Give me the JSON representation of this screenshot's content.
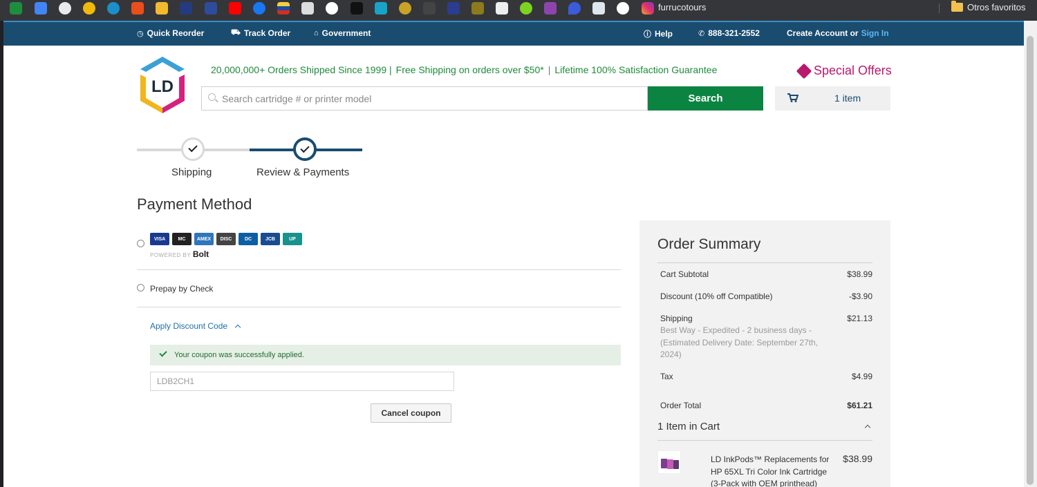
{
  "bookmarks": {
    "icons": [
      "drive-icon",
      "docs-icon",
      "globe-icon",
      "coin-icon",
      "circle-icon",
      "v-icon",
      "binance-icon",
      "paypal-icon",
      "z-icon",
      "youtube-icon",
      "facebook-icon",
      "flag-icon",
      "play-icon",
      "soccer-icon",
      "p-icon",
      "s-icon",
      "crown-icon",
      "tree-icon",
      "shield-icon",
      "g-icon",
      "os-icon",
      "green-icon",
      "mask-icon",
      "drop-icon",
      "bird-icon",
      "soccer-icon-2"
    ],
    "instagram_label": "furrucotours",
    "folder_label": "Otros favoritos"
  },
  "topnav": {
    "quick_reorder": "Quick Reorder",
    "track_order": "Track Order",
    "government": "Government",
    "help": "Help",
    "phone": "888-321-2552",
    "create_account": "Create Account or",
    "sign_in": "Sign In"
  },
  "header": {
    "logo_text": "LD",
    "tagline_1": "20,000,000+ Orders Shipped Since 1999 |",
    "tagline_2": "Free Shipping on orders over $50*",
    "tagline_3": "Lifetime 100% Satisfaction Guarantee",
    "special_offers": "Special Offers",
    "search_placeholder": "Search cartridge # or printer model",
    "search_button": "Search",
    "cart_label": "1 item"
  },
  "steps": {
    "step1": "Shipping",
    "step2": "Review & Payments"
  },
  "payment": {
    "title": "Payment Method",
    "cards": [
      {
        "name": "VISA",
        "color": "#1a3a8f"
      },
      {
        "name": "MC",
        "color": "#222222"
      },
      {
        "name": "AMEX",
        "color": "#2e77bb"
      },
      {
        "name": "DISC",
        "color": "#444444"
      },
      {
        "name": "DC",
        "color": "#0d5fa5"
      },
      {
        "name": "JCB",
        "color": "#1a4c8f"
      },
      {
        "name": "UP",
        "color": "#18928c"
      }
    ],
    "powered_by": "POWERED BY",
    "bolt": "Bolt",
    "prepay_label": "Prepay by Check",
    "discount_toggle": "Apply Discount Code",
    "coupon_success": "Your coupon was successfully applied.",
    "coupon_value": "LDB2CH1",
    "cancel_coupon": "Cancel coupon"
  },
  "summary": {
    "title": "Order Summary",
    "cart_subtotal_label": "Cart Subtotal",
    "cart_subtotal_value": "$38.99",
    "discount_label": "Discount (10% off Compatible)",
    "discount_value": "-$3.90",
    "shipping_label": "Shipping",
    "shipping_value": "$21.13",
    "shipping_detail": "Best Way - Expedited - 2 business days - (Estimated Delivery Date: September 27th, 2024)",
    "tax_label": "Tax",
    "tax_value": "$4.99",
    "order_total_label": "Order Total",
    "order_total_value": "$61.21",
    "items_in_cart": "1 Item in Cart",
    "product_name": "LD InkPods™ Replacements for HP 65XL Tri Color Ink Cartridge (3-Pack with OEM printhead)",
    "product_price": "$38.99"
  },
  "colors": {
    "nav_bg": "#1a4c70",
    "accent_green": "#0c8441",
    "special_offers": "#b8196e",
    "link_blue": "#1f6fa5"
  }
}
